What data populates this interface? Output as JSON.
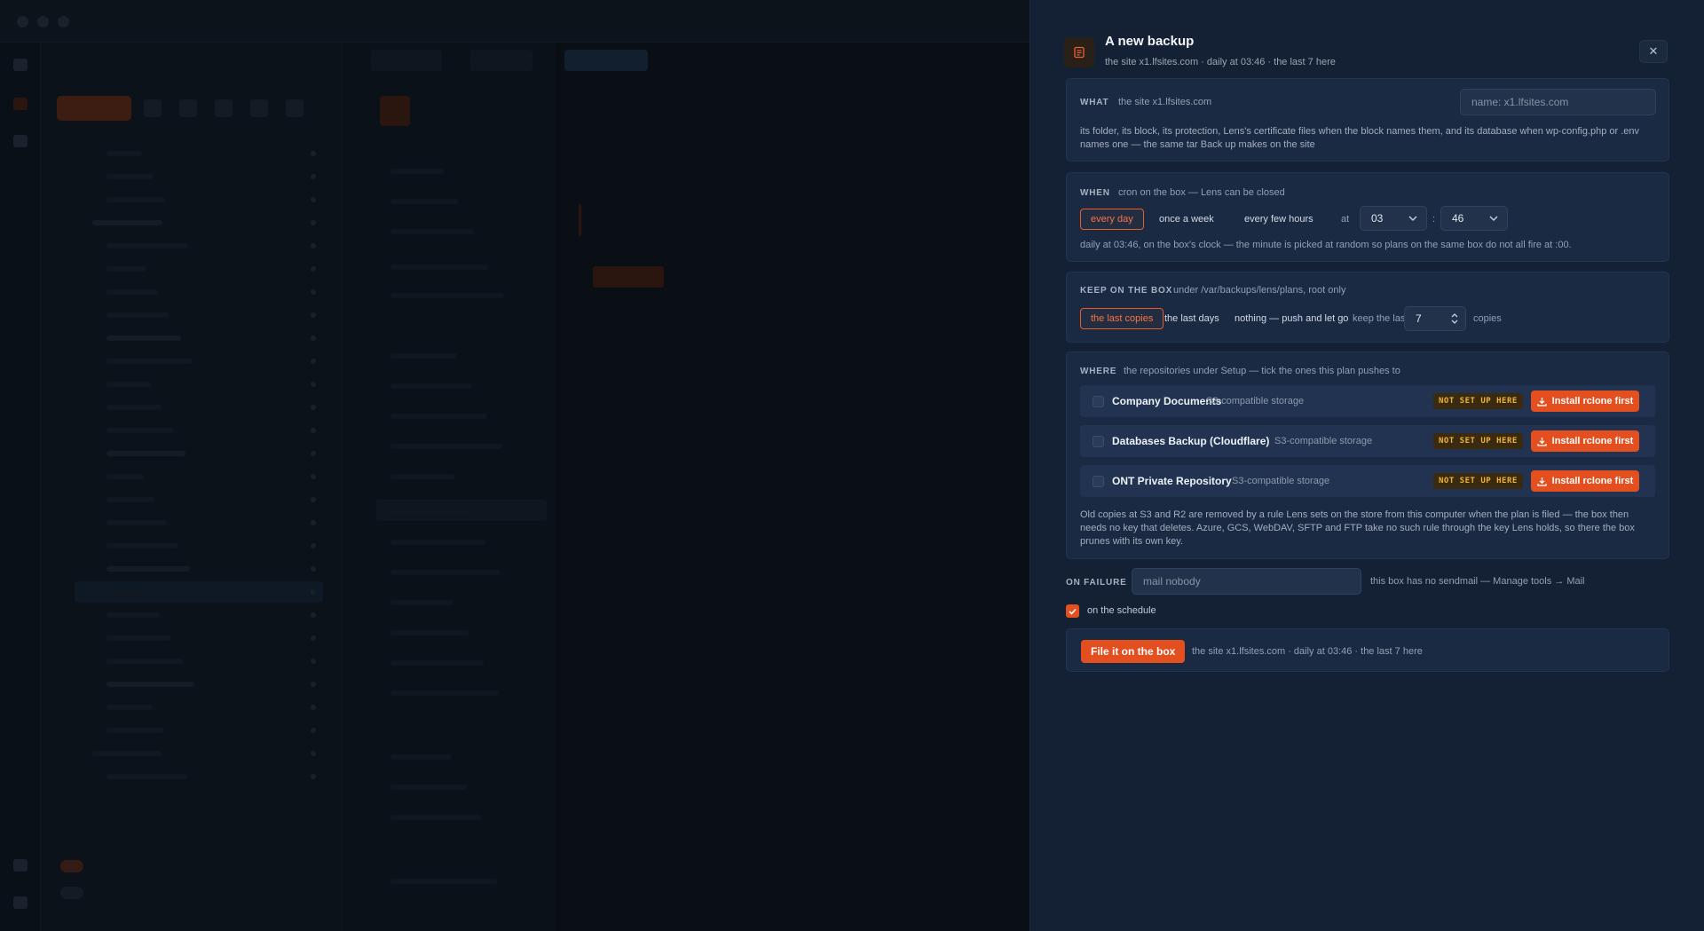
{
  "header": {
    "title": "A new backup",
    "subtitle": "the site x1.lfsites.com · daily at 03:46 · the last 7 here",
    "close_label": "✕"
  },
  "what": {
    "label": "WHAT",
    "desc": "the site x1.lfsites.com",
    "name_placeholder": "name: x1.lfsites.com",
    "body": "its folder, its block, its protection, Lens's certificate files when the block names them, and its database when wp-config.php or .env names one — the same tar Back up makes on the site"
  },
  "when": {
    "label": "WHEN",
    "desc": "cron on the box — Lens can be closed",
    "options": [
      "every day",
      "once a week",
      "every few hours"
    ],
    "active_index": 0,
    "at_label": "at",
    "hour": "03",
    "colon": ":",
    "minute": "46",
    "note": "daily at 03:46, on the box's clock — the minute is picked at random so plans on the same box do not all fire at :00."
  },
  "keep": {
    "label": "KEEP ON THE BOX",
    "desc": "under /var/backups/lens/plans, root only",
    "options": [
      "the last copies",
      "the last days",
      "nothing — push and let go"
    ],
    "active_index": 0,
    "keep_label": "keep the last",
    "count": "7",
    "unit": "copies"
  },
  "where": {
    "label": "WHERE",
    "desc": "the repositories under Setup — tick the ones this plan pushes to",
    "repos": [
      {
        "name": "Company Documents",
        "type": "S3-compatible storage",
        "status": "NOT SET UP HERE",
        "action": "Install rclone first"
      },
      {
        "name": "Databases Backup (Cloudflare)",
        "type": "S3-compatible storage",
        "status": "NOT SET UP HERE",
        "action": "Install rclone first"
      },
      {
        "name": "ONT Private Repository",
        "type": "S3-compatible storage",
        "status": "NOT SET UP HERE",
        "action": "Install rclone first"
      }
    ],
    "note": "Old copies at S3 and R2 are removed by a rule Lens sets on the store from this computer when the plan is filed — the box then needs no key that deletes. Azure, GCS, WebDAV, SFTP and FTP take no such rule through the key Lens holds, so there the box prunes with its own key."
  },
  "failure": {
    "label": "ON FAILURE",
    "placeholder": "mail nobody",
    "note": "this box has no sendmail — Manage tools → Mail"
  },
  "schedule": {
    "checked": true,
    "label": "on the schedule"
  },
  "footer": {
    "button": "File it on the box",
    "summary": "the site x1.lfsites.com · daily at 03:46 · the last 7 here"
  },
  "colors": {
    "accent": "#e44f1f",
    "panel_bg": "#142033",
    "card_bg": "#1a2a42",
    "badge_text": "#f0b339"
  }
}
